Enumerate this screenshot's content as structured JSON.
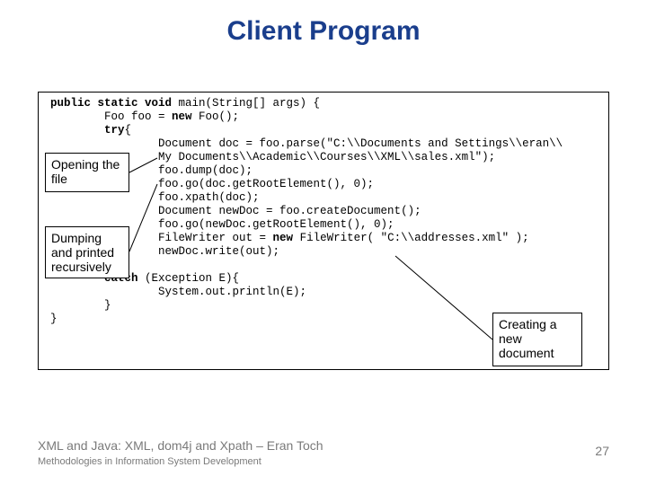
{
  "title": "Client Program",
  "code": {
    "l1_pre": "public static void",
    "l1_post": " main(String[] args) {",
    "l2_pre": "        Foo foo = ",
    "l2_kw": "new",
    "l2_post": " Foo();",
    "l3_pre": "        ",
    "l3_kw": "try",
    "l3_post": "{",
    "l4": "                Document doc = foo.parse(\"C:\\\\Documents and Settings\\\\eran\\\\",
    "l5": "                My Documents\\\\Academic\\\\Courses\\\\XML\\\\sales.xml\");",
    "l6": "                foo.dump(doc);",
    "l7": "                foo.go(doc.getRootElement(), 0);",
    "l8": "                foo.xpath(doc);",
    "l9": "                Document newDoc = foo.createDocument();",
    "l10": "                foo.go(newDoc.getRootElement(), 0);",
    "l11_pre": "                FileWriter out = ",
    "l11_kw": "new",
    "l11_post": " FileWriter( \"C:\\\\addresses.xml\" );",
    "l12": "                newDoc.write(out);",
    "l13": "        }",
    "l14_pre": "        ",
    "l14_kw": "catch",
    "l14_post": " (Exception E){",
    "l15": "                System.out.println(E);",
    "l16": "        }",
    "l17": "}"
  },
  "callouts": {
    "c1": "Opening the file",
    "c2": "Dumping and printed recursively",
    "c3": "Creating a new document"
  },
  "footer": {
    "main": "XML and Java: XML, dom4j and Xpath – Eran Toch",
    "sub": "Methodologies in Information System Development"
  },
  "pagenum": "27"
}
